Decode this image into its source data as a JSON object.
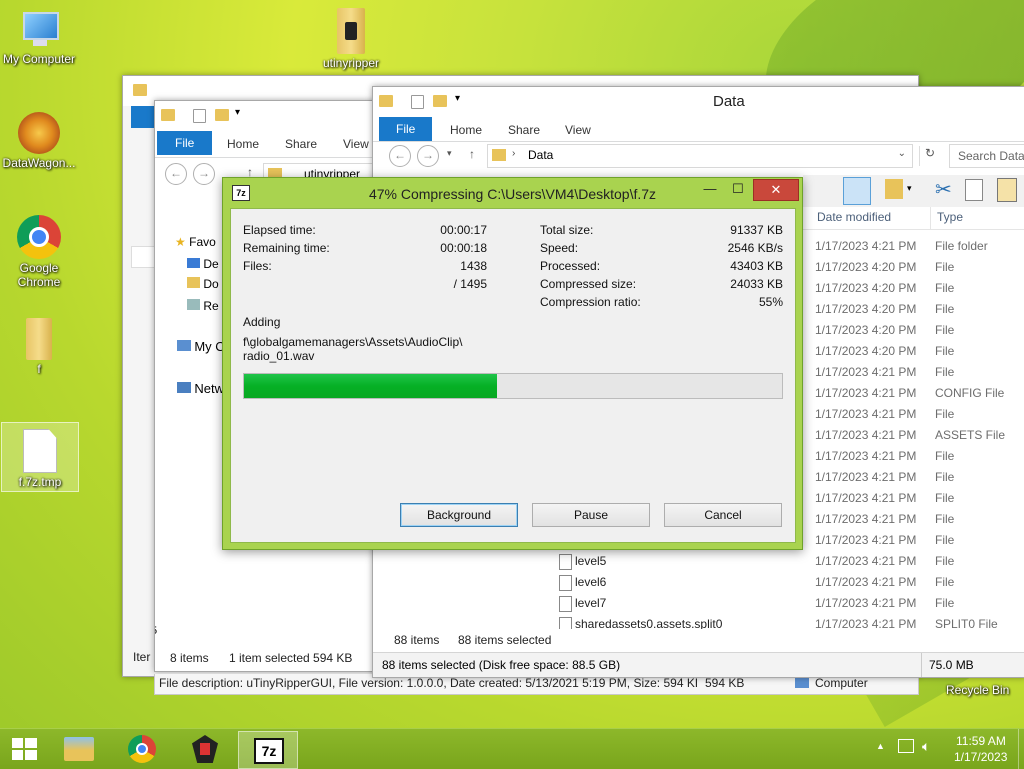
{
  "desktop": {
    "icons": [
      {
        "label": "My Computer"
      },
      {
        "label": "utinyripper"
      },
      {
        "label": "DataWagon..."
      },
      {
        "label": "Google Chrome"
      },
      {
        "label": "f"
      },
      {
        "label": "f.7z.tmp"
      }
    ],
    "recycle_bin": "Recycle Bin"
  },
  "explorer_back": {
    "tabs": [
      "File",
      "Home",
      "Share",
      "View"
    ],
    "address": "utinyripper",
    "nav": [
      "Favo",
      "De",
      "Do",
      "Re",
      "My C",
      "Netw"
    ],
    "status_left": "Iter",
    "status_count": "8 items",
    "status_selected": "1 item selected  594 KB",
    "file_description": "File description: uTinyRipperGUI, File version: 1.0.0.0, Date created: 5/13/2021 5:19 PM, Size: 594 KB",
    "size_right": "594 KB",
    "computer": "Computer",
    "num5": "5"
  },
  "explorer_data": {
    "title": "Data",
    "tabs": [
      "File",
      "Home",
      "Share",
      "View"
    ],
    "address": "Data",
    "search_placeholder": "Search Data",
    "columns": {
      "date": "Date modified",
      "type": "Type"
    },
    "rows": [
      {
        "name": "",
        "date": "1/17/2023 4:21 PM",
        "type": "File folder"
      },
      {
        "name": "",
        "date": "1/17/2023 4:20 PM",
        "type": "File"
      },
      {
        "name": "",
        "date": "1/17/2023 4:20 PM",
        "type": "File"
      },
      {
        "name": "",
        "date": "1/17/2023 4:20 PM",
        "type": "File"
      },
      {
        "name": "",
        "date": "1/17/2023 4:20 PM",
        "type": "File"
      },
      {
        "name": "",
        "date": "1/17/2023 4:20 PM",
        "type": "File"
      },
      {
        "name": "",
        "date": "1/17/2023 4:21 PM",
        "type": "File"
      },
      {
        "name": "",
        "date": "1/17/2023 4:21 PM",
        "type": "CONFIG File"
      },
      {
        "name": "",
        "date": "1/17/2023 4:21 PM",
        "type": "File"
      },
      {
        "name": "",
        "date": "1/17/2023 4:21 PM",
        "type": "ASSETS File"
      },
      {
        "name": "",
        "date": "1/17/2023 4:21 PM",
        "type": "File"
      },
      {
        "name": "",
        "date": "1/17/2023 4:21 PM",
        "type": "File"
      },
      {
        "name": "",
        "date": "1/17/2023 4:21 PM",
        "type": "File"
      },
      {
        "name": "",
        "date": "1/17/2023 4:21 PM",
        "type": "File"
      },
      {
        "name": "",
        "date": "1/17/2023 4:21 PM",
        "type": "File"
      },
      {
        "name": "level5",
        "date": "1/17/2023 4:21 PM",
        "type": "File"
      },
      {
        "name": "level6",
        "date": "1/17/2023 4:21 PM",
        "type": "File"
      },
      {
        "name": "level7",
        "date": "1/17/2023 4:21 PM",
        "type": "File"
      },
      {
        "name": "sharedassets0.assets.split0",
        "date": "1/17/2023 4:21 PM",
        "type": "SPLIT0 File"
      }
    ],
    "status_count": "88 items",
    "status_selected": "88 items selected",
    "details": "88 items selected (Disk free space: 88.5 GB)",
    "details_size": "75.0 MB"
  },
  "dialog": {
    "title": "47% Compressing C:\\Users\\VM4\\Desktop\\f.7z",
    "icon_text": "7z",
    "progress_percent": 47,
    "left_stats": [
      {
        "label": "Elapsed time:",
        "value": "00:00:17"
      },
      {
        "label": "Remaining time:",
        "value": "00:00:18"
      },
      {
        "label": "Files:",
        "value": "1438"
      },
      {
        "label": "",
        "value": "/ 1495"
      }
    ],
    "right_stats": [
      {
        "label": "Total size:",
        "value": "91337 KB"
      },
      {
        "label": "Speed:",
        "value": "2546 KB/s"
      },
      {
        "label": "Processed:",
        "value": "43403 KB"
      },
      {
        "label": "Compressed size:",
        "value": "24033 KB"
      },
      {
        "label": "Compression ratio:",
        "value": "55%"
      }
    ],
    "adding_label": "Adding",
    "adding_path_1": "f\\globalgamemanagers\\Assets\\AudioClip\\",
    "adding_path_2": "radio_01.wav",
    "buttons": {
      "background": "Background",
      "pause": "Pause",
      "cancel": "Cancel"
    }
  },
  "taskbar": {
    "time": "11:59 AM",
    "date": "1/17/2023"
  },
  "colors": {
    "accent": "#1979ca",
    "progress": "#06b025",
    "dialog_frame": "#a9d34f",
    "close": "#c9483b"
  }
}
